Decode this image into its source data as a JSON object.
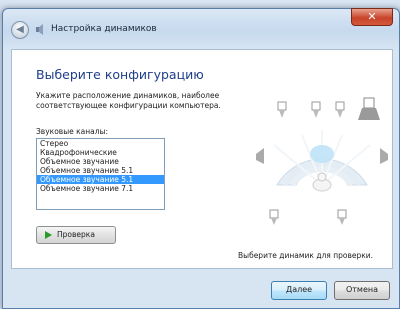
{
  "window": {
    "title": "Настройка динамиков",
    "close_glyph": "✕",
    "back_glyph": "◀"
  },
  "content": {
    "heading": "Выберите конфигурацию",
    "instruction": "Укажите расположение динамиков, наиболее соответствующее конфигурации компьютера.",
    "channels_label": "Звуковые каналы:",
    "channels": [
      {
        "label": "Стерео",
        "selected": false
      },
      {
        "label": "Квадрофонические",
        "selected": false
      },
      {
        "label": "Объемное звучание",
        "selected": false
      },
      {
        "label": "Объемное звучание 5.1",
        "selected": false
      },
      {
        "label": "Объемное звучание 5.1",
        "selected": true
      },
      {
        "label": "Объемное звучание 7.1",
        "selected": false
      }
    ],
    "test_button": "Проверка",
    "test_hint": "Выберите динамик для проверки."
  },
  "footer": {
    "next": "Далее",
    "cancel": "Отмена"
  },
  "colors": {
    "accent": "#3399ff",
    "heading": "#1f3e8a",
    "play": "#2a9a2a"
  },
  "icons": [
    "back-arrow-icon",
    "speaker-settings-icon",
    "play-icon",
    "close-icon"
  ]
}
